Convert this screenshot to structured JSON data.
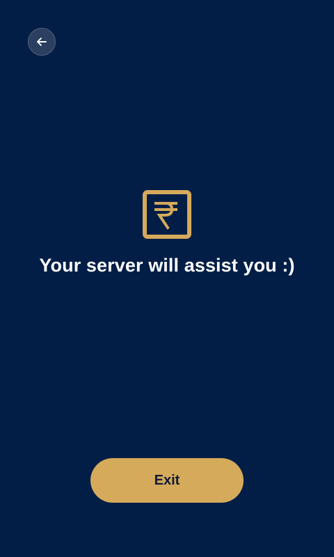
{
  "header": {
    "back_icon": "arrow-left-icon"
  },
  "main": {
    "icon": "rupee-icon",
    "message": "Your server will assist you :)"
  },
  "footer": {
    "exit_label": "Exit"
  },
  "colors": {
    "background": "#021e46",
    "accent": "#d5aa5b",
    "text": "#ffffff"
  }
}
